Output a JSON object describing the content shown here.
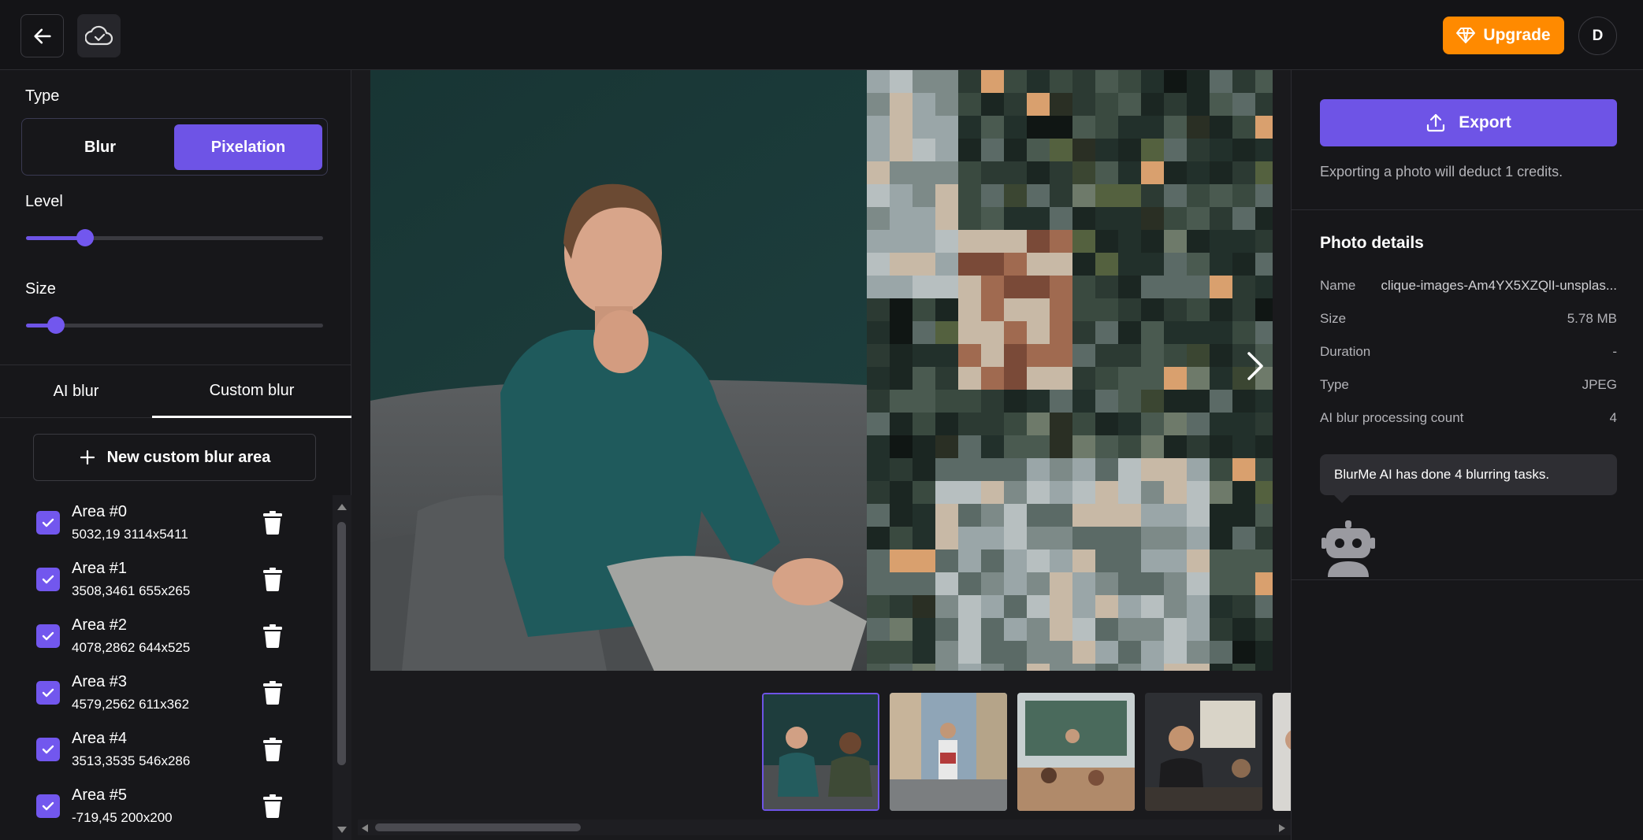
{
  "topbar": {
    "upgrade_label": "Upgrade",
    "avatar_initial": "D"
  },
  "left": {
    "type_label": "Type",
    "type_options": [
      "Blur",
      "Pixelation"
    ],
    "type_selected": "Pixelation",
    "level_label": "Level",
    "level_value": 0.2,
    "size_label": "Size",
    "size_value": 0.1,
    "tabs": [
      "AI blur",
      "Custom blur"
    ],
    "tab_selected": "Custom blur",
    "new_area_label": "New custom blur area",
    "areas": [
      {
        "name": "Area #0",
        "coords": "5032,19 3114x5411",
        "checked": true
      },
      {
        "name": "Area #1",
        "coords": "3508,3461 655x265",
        "checked": true
      },
      {
        "name": "Area #2",
        "coords": "4078,2862 644x525",
        "checked": true
      },
      {
        "name": "Area #3",
        "coords": "4579,2562 611x362",
        "checked": true
      },
      {
        "name": "Area #4",
        "coords": "3513,3535 546x286",
        "checked": true
      },
      {
        "name": "Area #5",
        "coords": "-719,45 200x200",
        "checked": true
      }
    ]
  },
  "right": {
    "export_label": "Export",
    "export_note": "Exporting a photo will deduct 1 credits.",
    "details_title": "Photo details",
    "details": [
      {
        "key": "Name",
        "value": "clique-images-Am4YX5XZQlI-unsplas..."
      },
      {
        "key": "Size",
        "value": "5.78 MB"
      },
      {
        "key": "Duration",
        "value": "-"
      },
      {
        "key": "Type",
        "value": "JPEG"
      },
      {
        "key": "AI blur processing count",
        "value": "4"
      }
    ],
    "bubble_text": "BlurMe AI has done 4 blurring tasks."
  },
  "colors": {
    "accent": "#6e54e6",
    "upgrade": "#ff8a00",
    "background": "#1a1a1d"
  }
}
